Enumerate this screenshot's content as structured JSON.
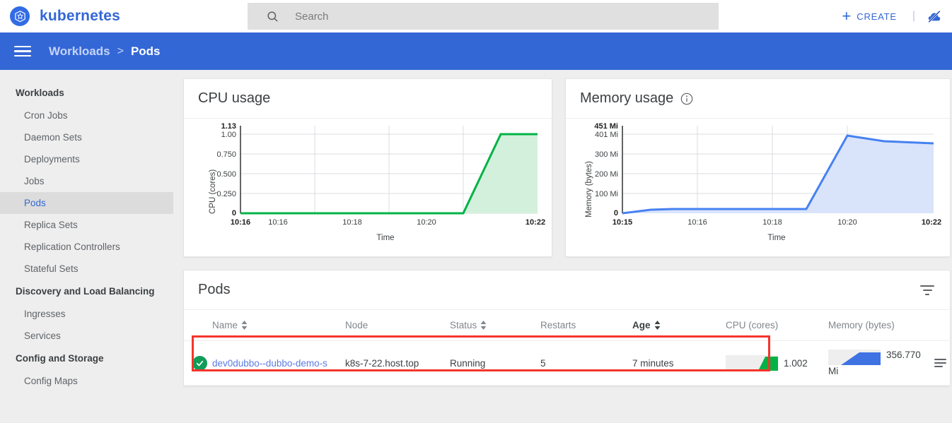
{
  "topbar": {
    "brand": "kubernetes",
    "logo_icon": "kubernetes-helm-icon",
    "search_icon": "search-icon",
    "search_placeholder": "Search",
    "search_value": "",
    "create_plus": "+",
    "create_label": "CREATE",
    "divider": "|",
    "right_icon": "no-notifications-slashed-icon"
  },
  "breadcrumb": {
    "menu_icon": "hamburger-menu-icon",
    "parent": "Workloads",
    "separator": ">",
    "current": "Pods"
  },
  "sidebar": {
    "sections": [
      {
        "header": "Workloads",
        "items": [
          {
            "label": "Cron Jobs",
            "active": false
          },
          {
            "label": "Daemon Sets",
            "active": false
          },
          {
            "label": "Deployments",
            "active": false
          },
          {
            "label": "Jobs",
            "active": false
          },
          {
            "label": "Pods",
            "active": true
          },
          {
            "label": "Replica Sets",
            "active": false
          },
          {
            "label": "Replication Controllers",
            "active": false
          },
          {
            "label": "Stateful Sets",
            "active": false
          }
        ]
      },
      {
        "header": "Discovery and Load Balancing",
        "items": [
          {
            "label": "Ingresses",
            "active": false
          },
          {
            "label": "Services",
            "active": false
          }
        ]
      },
      {
        "header": "Config and Storage",
        "items": [
          {
            "label": "Config Maps",
            "active": false
          }
        ]
      }
    ]
  },
  "cards": {
    "cpu_title": "CPU usage",
    "memory_title": "Memory usage",
    "memory_info_icon": "info-icon"
  },
  "pods_card": {
    "title": "Pods",
    "filter_icon": "filter-icon",
    "columns": [
      {
        "label": "Name",
        "sortable": true,
        "sorted": false
      },
      {
        "label": "Node",
        "sortable": false,
        "sorted": false
      },
      {
        "label": "Status",
        "sortable": true,
        "sorted": false
      },
      {
        "label": "Restarts",
        "sortable": false,
        "sorted": false
      },
      {
        "label": "Age",
        "sortable": true,
        "sorted": true
      },
      {
        "label": "CPU (cores)",
        "sortable": false,
        "sorted": false
      },
      {
        "label": "Memory (bytes)",
        "sortable": false,
        "sorted": false
      }
    ],
    "rows": [
      {
        "status_icon": "check-circle-icon",
        "status_color": "#0f9d58",
        "name": "dev0dubbo--dubbo-demo-s",
        "node": "k8s-7-22.host.top",
        "status": "Running",
        "restarts": "5",
        "age": "7 minutes",
        "cpu_value": "1.002",
        "memory_value": "356.770",
        "memory_unit": "Mi",
        "logs_icon": "logs-icon",
        "menu_icon": "kebab-menu-icon"
      }
    ],
    "highlight_color": "#f4352b"
  },
  "chart_data": [
    {
      "type": "area",
      "title": "CPU usage",
      "xlabel": "Time",
      "ylabel": "CPU (cores)",
      "color": "#00b344",
      "fill": "#d3f0dd",
      "ylim": [
        0,
        1.13
      ],
      "yticks": [
        "0",
        "0.250",
        "0.500",
        "0.750",
        "1.00",
        "1.13"
      ],
      "ytick_values": [
        0,
        0.25,
        0.5,
        0.75,
        1.0,
        1.13
      ],
      "ymax_label": "1.13",
      "xticks": [
        "10:16",
        "10:16",
        "10:18",
        "10:20",
        "10:22"
      ],
      "xtick_bold": [
        true,
        false,
        false,
        false,
        true
      ],
      "x": [
        "10:16",
        "10:17",
        "10:18",
        "10:19",
        "10:20",
        "10:21",
        "10:22"
      ],
      "values": [
        0,
        0,
        0,
        0,
        0,
        1.0,
        1.0
      ],
      "grid": true
    },
    {
      "type": "area",
      "title": "Memory usage",
      "xlabel": "Time",
      "ylabel": "Memory (bytes)",
      "color": "#4681f0",
      "fill": "#d9e4fb",
      "ylim": [
        0,
        451
      ],
      "yticks": [
        "0",
        "100 Mi",
        "200 Mi",
        "300 Mi",
        "401 Mi",
        "451 Mi"
      ],
      "ytick_values": [
        0,
        100,
        200,
        300,
        401,
        451
      ],
      "ymax_label": "451 Mi",
      "xticks": [
        "10:15",
        "10:16",
        "10:18",
        "10:20",
        "10:22"
      ],
      "xtick_bold": [
        true,
        false,
        false,
        false,
        true
      ],
      "x": [
        "10:15",
        "10:15.5",
        "10:16",
        "10:18",
        "10:19",
        "10:20",
        "10:21",
        "10:22"
      ],
      "values": [
        0,
        18,
        20,
        20,
        18,
        401,
        370,
        356
      ],
      "grid": true
    }
  ]
}
